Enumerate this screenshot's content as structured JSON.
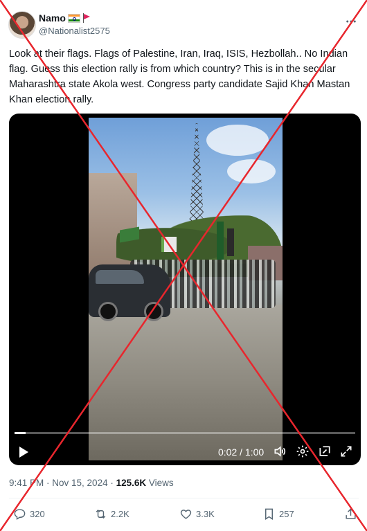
{
  "author": {
    "display_name": "Namo",
    "handle": "@Nationalist2575",
    "badge_icons": [
      "india-flag-icon",
      "red-flag-icon"
    ]
  },
  "tweet": {
    "text": "Look at their flags. Flags of Palestine, Iran, Iraq, ISIS, Hezbollah.. No Indian flag. Guess this election rally is from which country? This is in the secular Maharashtra state Akola west. Congress party candidate Sajid Khan Mastan Khan election rally."
  },
  "video": {
    "time_display": "0:02 / 1:00",
    "progress_fraction": 0.033,
    "controls": [
      "play-icon",
      "volume-icon",
      "settings-icon",
      "pip-icon",
      "fullscreen-icon"
    ]
  },
  "meta": {
    "timestamp": "9:41 PM · Nov 15, 2024",
    "separator": " · ",
    "views_count": "125.6K",
    "views_label": " Views"
  },
  "actions": {
    "replies": "320",
    "reposts": "2.2K",
    "likes": "3.3K",
    "bookmarks": "257"
  },
  "overlay": {
    "type": "red-cross",
    "color": "#e8262d"
  }
}
